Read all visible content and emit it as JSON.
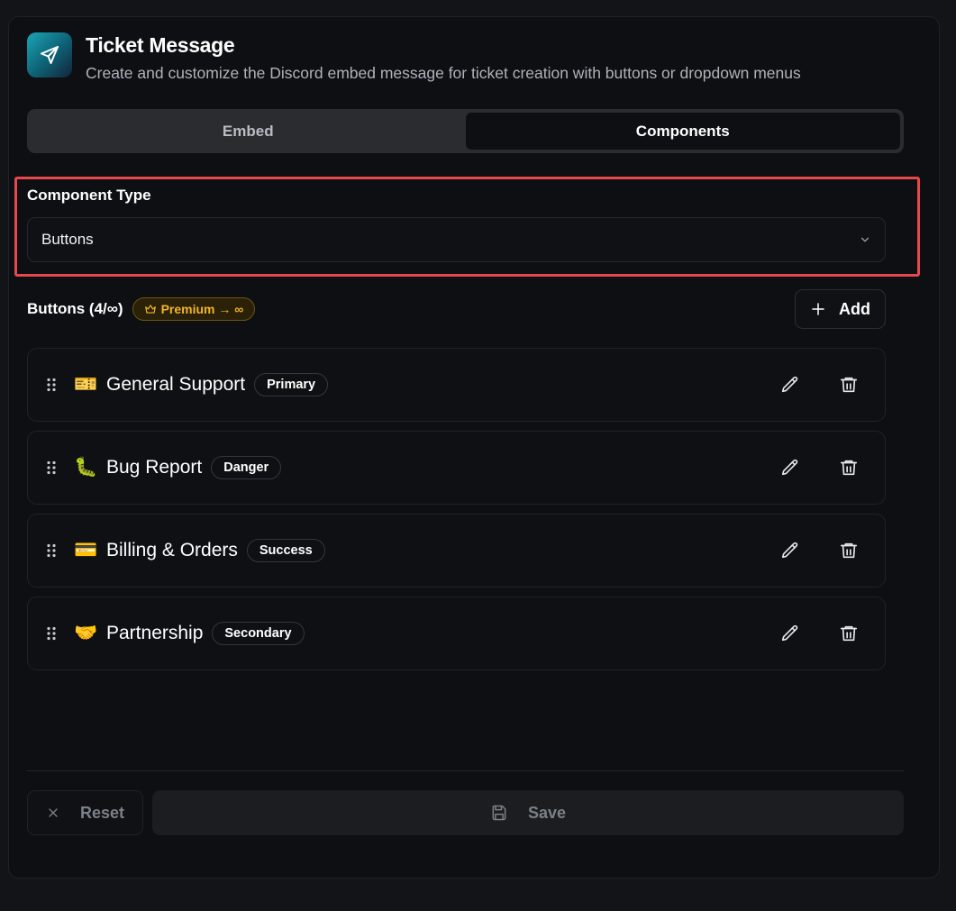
{
  "header": {
    "title": "Ticket Message",
    "subtitle": "Create and customize the Discord embed message for ticket creation with buttons or dropdown menus",
    "icon": "paper-plane-icon"
  },
  "tabs": [
    {
      "label": "Embed",
      "active": false
    },
    {
      "label": "Components",
      "active": true
    }
  ],
  "component_type": {
    "label": "Component Type",
    "value": "Buttons"
  },
  "buttons_section": {
    "title": "Buttons (4/∞)",
    "premium_label": "Premium → ∞",
    "add_label": "Add"
  },
  "items": [
    {
      "emoji": "🎫",
      "label": "General Support",
      "style": "Primary"
    },
    {
      "emoji": "🐛",
      "label": "Bug Report",
      "style": "Danger"
    },
    {
      "emoji": "💳",
      "label": "Billing & Orders",
      "style": "Success"
    },
    {
      "emoji": "🤝",
      "label": "Partnership",
      "style": "Secondary"
    }
  ],
  "footer": {
    "reset_label": "Reset",
    "save_label": "Save"
  },
  "colors": {
    "background": "#121417",
    "card": "#0d0f12",
    "highlight": "#e5484d",
    "premium": "#f1b52a"
  }
}
